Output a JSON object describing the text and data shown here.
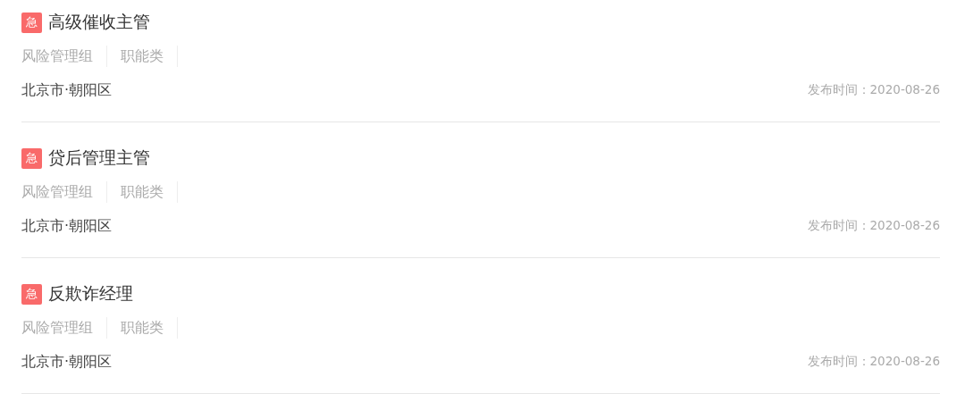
{
  "jobs": [
    {
      "badge": "急",
      "title": "高级催收主管",
      "tags": [
        "风险管理组",
        "职能类"
      ],
      "location": "北京市·朝阳区",
      "published": "发布时间：2020-08-26"
    },
    {
      "badge": "急",
      "title": "贷后管理主管",
      "tags": [
        "风险管理组",
        "职能类"
      ],
      "location": "北京市·朝阳区",
      "published": "发布时间：2020-08-26"
    },
    {
      "badge": "急",
      "title": "反欺诈经理",
      "tags": [
        "风险管理组",
        "职能类"
      ],
      "location": "北京市·朝阳区",
      "published": "发布时间：2020-08-26"
    }
  ]
}
